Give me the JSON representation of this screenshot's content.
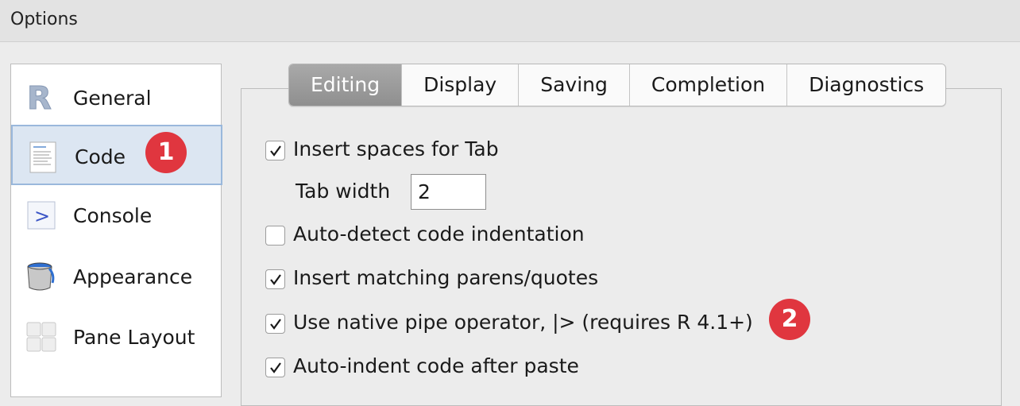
{
  "window": {
    "title": "Options"
  },
  "sidebar": {
    "items": [
      {
        "label": "General",
        "icon": "r-logo-icon",
        "selected": false
      },
      {
        "label": "Code",
        "icon": "code-document-icon",
        "selected": true
      },
      {
        "label": "Console",
        "icon": "console-prompt-icon",
        "selected": false
      },
      {
        "label": "Appearance",
        "icon": "paint-bucket-icon",
        "selected": false
      },
      {
        "label": "Pane Layout",
        "icon": "pane-grid-icon",
        "selected": false
      }
    ]
  },
  "tabs": [
    {
      "label": "Editing",
      "active": true
    },
    {
      "label": "Display",
      "active": false
    },
    {
      "label": "Saving",
      "active": false
    },
    {
      "label": "Completion",
      "active": false
    },
    {
      "label": "Diagnostics",
      "active": false
    }
  ],
  "editing": {
    "insert_spaces": {
      "label": "Insert spaces for Tab",
      "checked": true
    },
    "tab_width": {
      "label": "Tab width",
      "value": "2"
    },
    "auto_detect": {
      "label": "Auto-detect code indentation",
      "checked": false
    },
    "matching_parens": {
      "label": "Insert matching parens/quotes",
      "checked": true
    },
    "native_pipe": {
      "label": "Use native pipe operator, |> (requires R 4.1+)",
      "checked": true
    },
    "auto_indent": {
      "label": "Auto-indent code after paste",
      "checked": true
    }
  },
  "annotations": {
    "badge_1": "1",
    "badge_2": "2"
  },
  "colors": {
    "badge": "#e0363f",
    "selected_item_bg": "#dce6f2",
    "selected_item_border": "#9ab8dc",
    "active_tab": "#9a9a9a"
  }
}
